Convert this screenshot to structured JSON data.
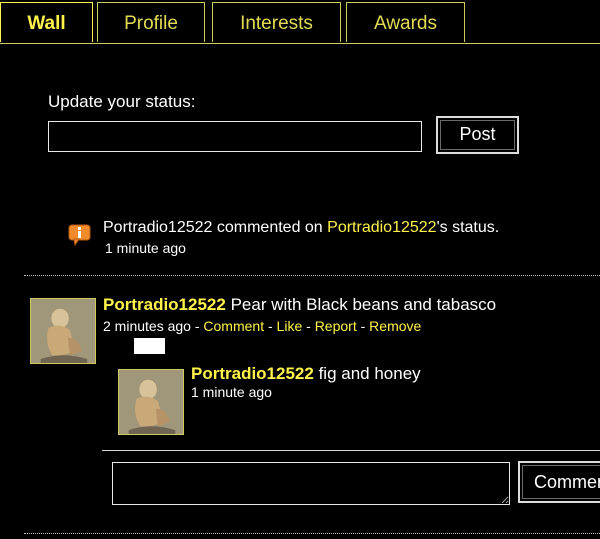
{
  "tabs": [
    {
      "label": "Wall",
      "active": true
    },
    {
      "label": "Profile",
      "active": false
    },
    {
      "label": "Interests",
      "active": false
    },
    {
      "label": "Awards",
      "active": false
    }
  ],
  "status": {
    "label": "Update your status:",
    "value": "",
    "post_label": "Post"
  },
  "notification": {
    "user": "Portradio12522",
    "action": " commented on ",
    "target": "Portradio12522",
    "suffix": "'s status.",
    "time": "1 minute ago",
    "icon": "notification-icon"
  },
  "post": {
    "author": "Portradio12522",
    "text": " Pear with Black beans and tabasco",
    "time": "2 minutes ago",
    "sep1": " - ",
    "actions": {
      "comment": "Comment",
      "like": "Like",
      "report": "Report",
      "remove": "Remove"
    },
    "sep2": " - ",
    "sep3": " - ",
    "sep4": "  - "
  },
  "comment": {
    "author": "Portradio12522",
    "text": " fig and honey",
    "time": "1 minute ago"
  },
  "comment_form": {
    "value": "",
    "button_label": "Comment"
  },
  "colors": {
    "background": "#000000",
    "link": "#fff24a",
    "tab_border": "#cfc85a",
    "text": "#ffffff"
  }
}
